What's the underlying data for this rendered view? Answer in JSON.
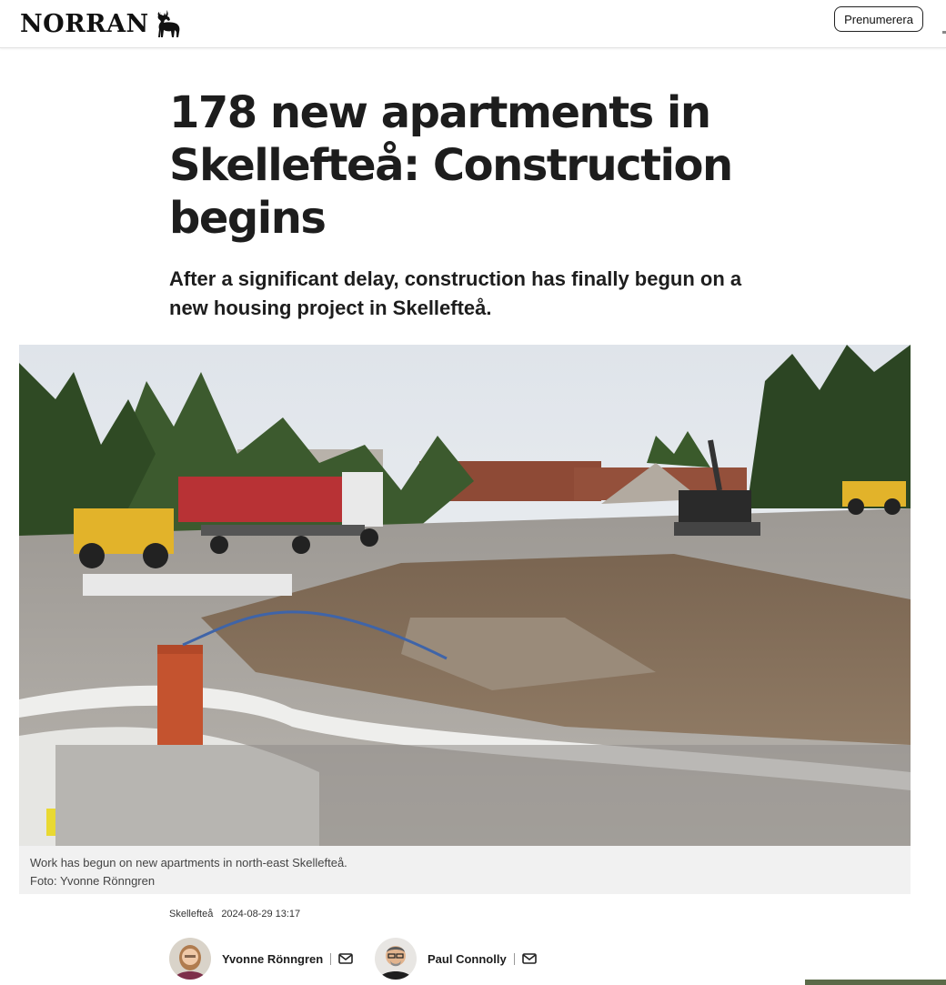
{
  "header": {
    "logo_text": "NORRAN",
    "logo_icon": "moose-icon",
    "subscribe_label": "Prenumerera"
  },
  "article": {
    "headline": "178 new apartments in Skellefteå: Construction begins",
    "lede": "After a significant delay, construction has finally begun on a new housing project in Skellefteå.",
    "caption": "Work has begun on new apartments in north-east Skellefteå.",
    "photo_credit": "Foto: Yvonne Rönngren",
    "location": "Skellefteå",
    "timestamp": "2024-08-29 13:17",
    "authors": [
      {
        "name": "Yvonne Rönngren",
        "icon": "mail-icon"
      },
      {
        "name": "Paul Connolly",
        "icon": "mail-icon"
      }
    ]
  },
  "colors": {
    "text": "#1d1d1d",
    "caption_bg": "#f1f1f1"
  }
}
